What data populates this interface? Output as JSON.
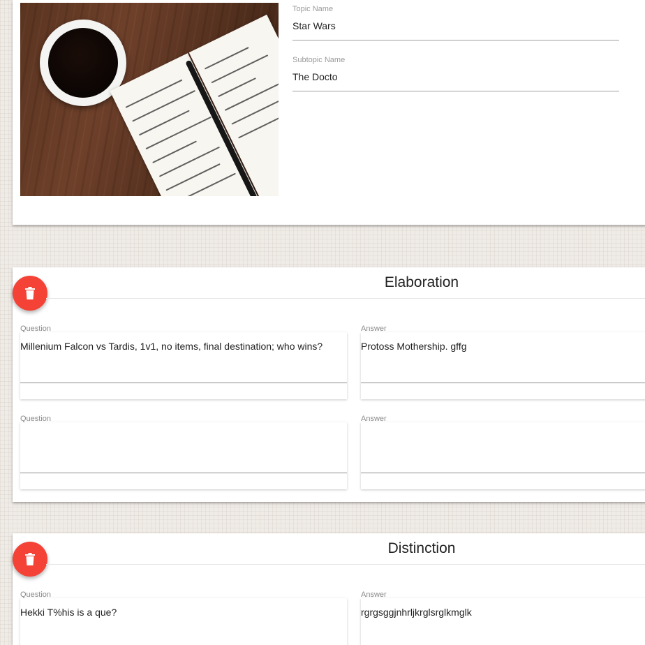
{
  "topic": {
    "topic_name_label": "Topic Name",
    "topic_name_value": "Star Wars",
    "subtopic_name_label": "Subtopic Name",
    "subtopic_name_value": "The Docto"
  },
  "cards": [
    {
      "title": "Elaboration",
      "delete_icon": "trash-icon",
      "pairs": [
        {
          "question_label": "Question",
          "question_value": "Millenium Falcon vs Tardis, 1v1, no items, final destination; who wins?",
          "answer_label": "Answer",
          "answer_value": "Protoss Mothership. gffg"
        },
        {
          "question_label": "Question",
          "question_value": "",
          "answer_label": "Answer",
          "answer_value": ""
        }
      ]
    },
    {
      "title": "Distinction",
      "delete_icon": "trash-icon",
      "pairs": [
        {
          "question_label": "Question",
          "question_value": "Hekki T%his is a que?",
          "answer_label": "Answer",
          "answer_value": "rgrgsggjnhrljkrglsrglkmglk"
        }
      ]
    }
  ],
  "colors": {
    "fab": "#f44336",
    "background": "#efebe6",
    "card": "#ffffff"
  }
}
